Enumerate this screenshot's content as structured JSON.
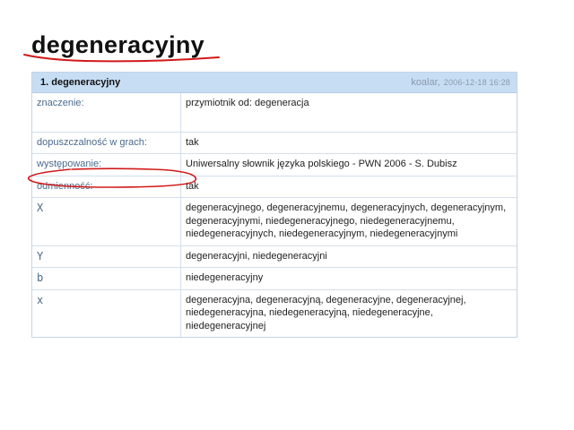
{
  "headword": "degeneracyjny",
  "entry": {
    "title": "1. degeneracyjny",
    "author": "koalar,",
    "date": "2006-12-18 16:28"
  },
  "rows": [
    {
      "label": "znaczenie:",
      "value": "przymiotnik od: degeneracja"
    },
    {
      "label": "dopuszczalność w grach:",
      "value": "tak"
    },
    {
      "label": "występowanie:",
      "value": "Uniwersalny słownik języka polskiego - PWN 2006 - S. Dubisz"
    },
    {
      "label": "odmienność:",
      "value": "tak"
    },
    {
      "label": "X",
      "value": "degeneracyjnego, degeneracyjnemu, degeneracyjnych, degeneracyjnym, degeneracyjnymi, niedegeneracyjnego, niedegeneracyjnemu, niedegeneracyjnych, niedegeneracyjnym, niedegeneracyjnymi"
    },
    {
      "label": "Y",
      "value": "degeneracyjni, niedegeneracyjni"
    },
    {
      "label": "b",
      "value": "niedegeneracyjny"
    },
    {
      "label": "x",
      "value": "degeneracyjna, degeneracyjną, degeneracyjne, degeneracyjnej, niedegeneracyjna, niedegeneracyjną, niedegeneracyjne, niedegeneracyjnej"
    }
  ],
  "annotation_color": "#d11a1a"
}
